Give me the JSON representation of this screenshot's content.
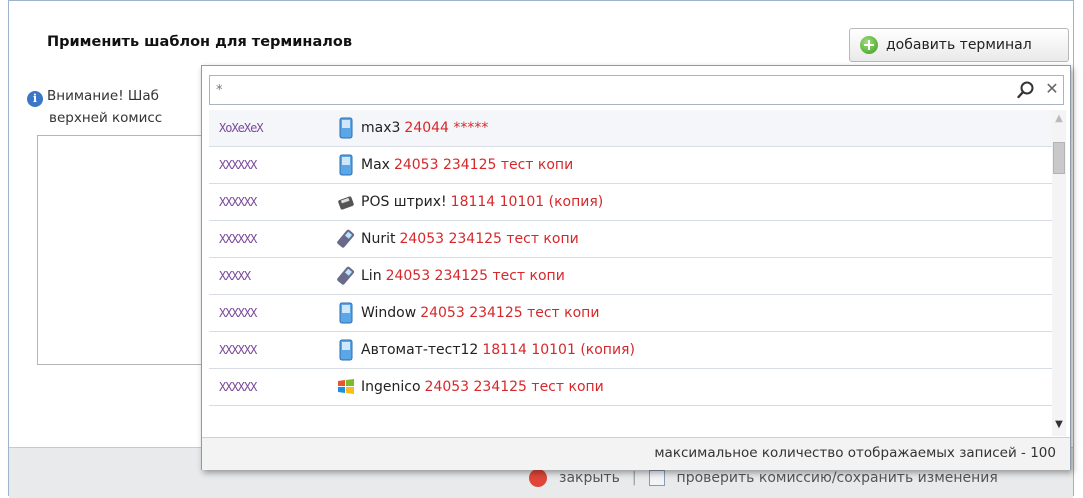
{
  "dialog": {
    "title": "Применить шаблон для терминалов",
    "add_button_label": "добавить терминал",
    "notice_line1": "Внимание! Шаб",
    "notice_line2": "верхней комисс"
  },
  "footer": {
    "close_label": "закрыть",
    "separator": "|",
    "save_label": "проверить комиссию/сохранить изменения"
  },
  "dropdown": {
    "search_placeholder": "*",
    "max_records_note": "максимальное количество отображаемых записей - 100",
    "items": [
      {
        "code": "XoXeXeX",
        "icon": "mobile-terminal-icon",
        "name": "max3",
        "detail": "24044 *****"
      },
      {
        "code": "XXXXXX",
        "icon": "mobile-terminal-icon",
        "name": "Max",
        "detail": "24053 234125 тест копи"
      },
      {
        "code": "XXXXXX",
        "icon": "pos-terminal-icon",
        "name": "POS штрих!",
        "detail": "18114 10101 (копия)"
      },
      {
        "code": "XXXXXX",
        "icon": "card-reader-icon",
        "name": "Nurit",
        "detail": "24053 234125 тест копи"
      },
      {
        "code": "XXXXX",
        "icon": "card-reader-icon",
        "name": "Lin",
        "detail": "24053 234125 тест копи"
      },
      {
        "code": "XXXXXX",
        "icon": "mobile-terminal-icon",
        "name": "Window",
        "detail": "24053 234125 тест копи"
      },
      {
        "code": "XXXXXX",
        "icon": "mobile-terminal-icon",
        "name": "Автомат-тест12",
        "detail": "18114 10101 (копия)"
      },
      {
        "code": "XXXXXX",
        "icon": "windows-logo-icon",
        "name": "Ingenico",
        "detail": "24053 234125 тест копи"
      }
    ]
  }
}
